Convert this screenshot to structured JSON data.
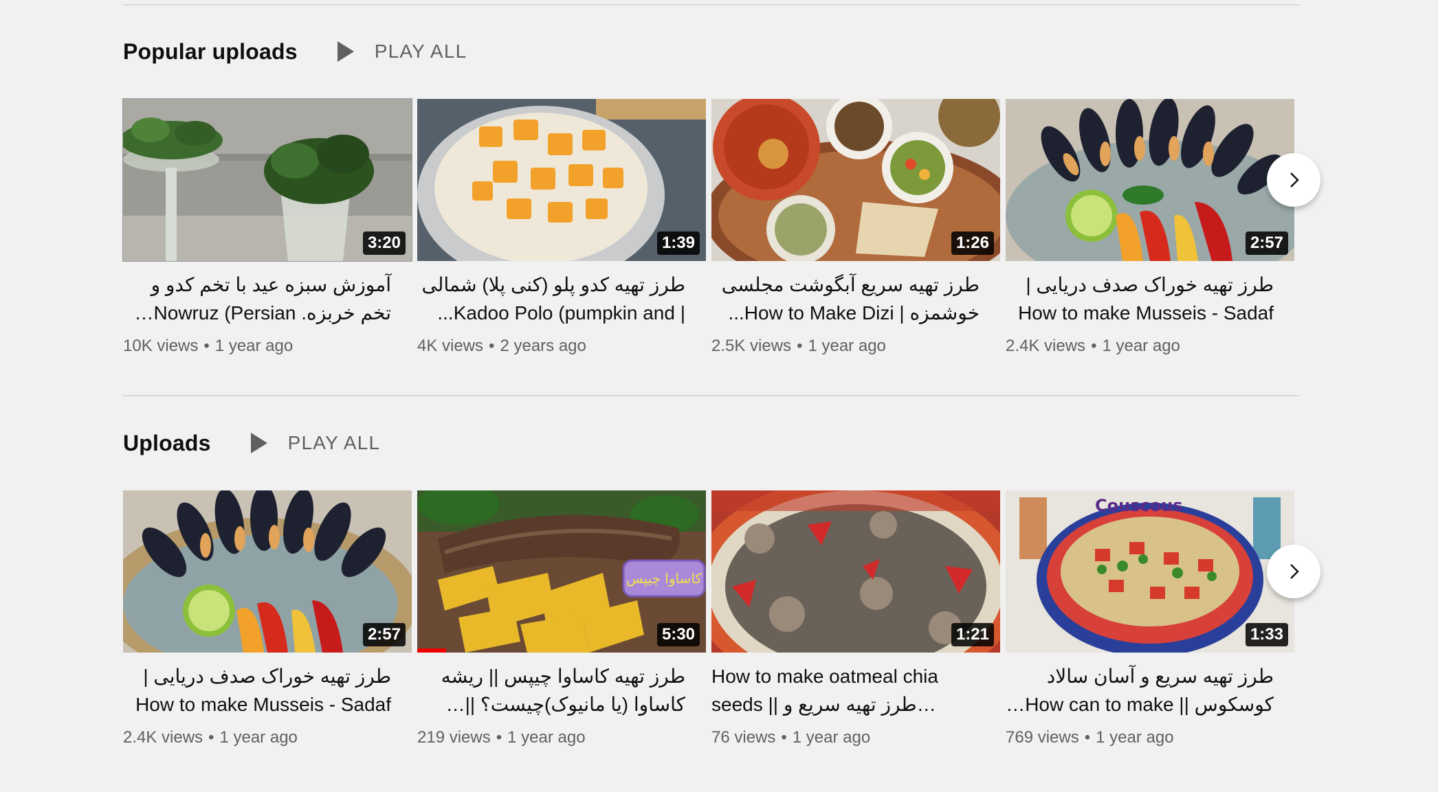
{
  "sections": [
    {
      "title": "Popular uploads",
      "play_all": "PLAY ALL",
      "videos": [
        {
          "title": "آموزش سبزه عید با تخم کدو و تخم خربزه. Nowruz (Persian New...",
          "duration": "3:20",
          "views": "10K views",
          "age": "1 year ago"
        },
        {
          "title": "طرز تهیه کدو پلو (کنی پلا) شمالی | Kadoo Polo (pumpkin and...",
          "duration": "1:39",
          "views": "4K views",
          "age": "2 years ago"
        },
        {
          "title": "طرز تهیه سریع آبگوشت مجلسی خوشمزه | How to Make Dizi...",
          "duration": "1:26",
          "views": "2.5K views",
          "age": "1 year ago"
        },
        {
          "title": "طرز تهیه خوراک صدف دریایی | How to make Musseis - Sadaf",
          "duration": "2:57",
          "views": "2.4K views",
          "age": "1 year ago"
        }
      ]
    },
    {
      "title": "Uploads",
      "play_all": "PLAY ALL",
      "videos": [
        {
          "title": "طرز تهیه خوراک صدف دریایی | How to make Musseis - Sadaf",
          "duration": "2:57",
          "views": "2.4K views",
          "age": "1 year ago"
        },
        {
          "title": "طرز تهیه کاساوا چیپس || ریشه کاساوا (یا مانیوک)چیست؟ || Cassava...",
          "duration": "5:30",
          "views": "219 views",
          "age": "1 year ago",
          "thumb_label": "کاساوا چیپس",
          "progress": 0.1
        },
        {
          "title": "How to make oatmeal chia seeds || طرز تهیه سریع و آسان...",
          "duration": "1:21",
          "views": "76 views",
          "age": "1 year ago"
        },
        {
          "title": "طرز تهیه سریع و آسان سالاد کوسکوس || How can to make Cousco...",
          "duration": "1:33",
          "views": "769 views",
          "age": "1 year ago",
          "thumb_label": "Couscous"
        }
      ]
    }
  ],
  "separator": "•",
  "icons": {
    "play": "play-icon",
    "next": "chevron-right-icon"
  },
  "colors": {
    "background": "#f1f1f1",
    "secondary_text": "#606060",
    "progress": "#ee0000"
  }
}
